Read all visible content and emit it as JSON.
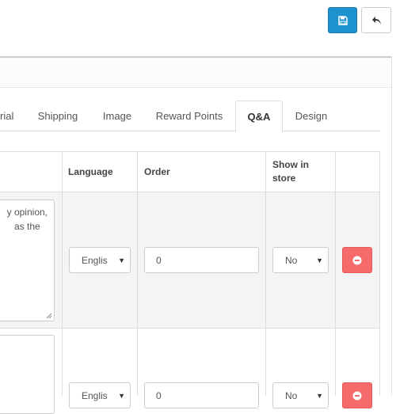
{
  "toolbar": {
    "save_icon": "save-icon",
    "back_icon": "reply-icon",
    "save_color": "#1e91cf",
    "remove_color": "#f56b6b"
  },
  "tabs": [
    {
      "label": "rial"
    },
    {
      "label": "Shipping"
    },
    {
      "label": "Image"
    },
    {
      "label": "Reward Points"
    },
    {
      "label": "Q&A",
      "active": true
    },
    {
      "label": "Design"
    }
  ],
  "table": {
    "headers": {
      "language": "Language",
      "order": "Order",
      "show_in_store_line1": "Show in",
      "show_in_store_line2": "store"
    },
    "rows": [
      {
        "answer_line1": "y opinion,",
        "answer_line2": "as the",
        "language": "Englis",
        "order": "0",
        "show_in_store": "No"
      },
      {
        "answer_line1": "",
        "answer_line2": "",
        "language": "Englis",
        "order": "0",
        "show_in_store": "No"
      }
    ]
  }
}
